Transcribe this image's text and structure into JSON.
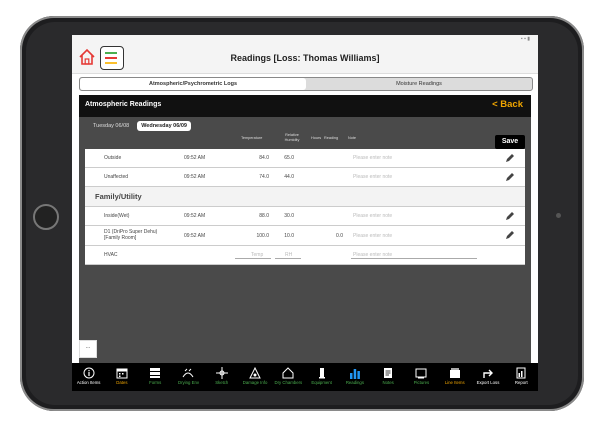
{
  "window": {
    "title": "Readings [Loss: Thomas  Williams]"
  },
  "segments": [
    "Atmospheric/Psychrometric Logs",
    "Moisture Readings"
  ],
  "panel": {
    "title": "Atmospheric  Readings",
    "back_label": "< Back"
  },
  "day_tabs": [
    "Tuesday 06/08",
    "Wednesday 06/09"
  ],
  "save_label": "Save",
  "columns": {
    "temperature": "Temperature",
    "relative_humidity": "Relative Humidity",
    "hours": "Hours",
    "reading": "Reading",
    "note": "Note"
  },
  "rows": [
    {
      "name": "Outside",
      "time": "09:52 AM",
      "temperature": "84.0",
      "humidity": "65.0",
      "note_placeholder": "Please enter note"
    },
    {
      "name": "Unaffected",
      "time": "09:52 AM",
      "temperature": "74.0",
      "humidity": "44.0",
      "note_placeholder": "Please enter note"
    },
    {
      "group": "Family/Utility"
    },
    {
      "name": "Inside(Wet)",
      "time": "09:52 AM",
      "temperature": "88.0",
      "humidity": "30.0",
      "note_placeholder": "Please enter note"
    },
    {
      "name": "D1 (DriPro Super Dehu) [Family Room]",
      "time": "09:52 AM",
      "temperature": "100.0",
      "humidity": "10.0",
      "reading": "0.0",
      "note_placeholder": "Please enter note"
    },
    {
      "name": "HVAC",
      "temp_placeholder": "Temp",
      "rh_placeholder": "RH",
      "note_placeholder": "Please enter note"
    }
  ],
  "chat_label": "...",
  "toolbar": [
    {
      "label": "Action Items",
      "icon": "info-icon",
      "color": "#ffffff"
    },
    {
      "label": "Dates",
      "icon": "calendar-icon",
      "color": "#f0a500"
    },
    {
      "label": "Forms",
      "icon": "forms-icon",
      "color": "#4caf50"
    },
    {
      "label": "Drying Env",
      "icon": "drying-env-icon",
      "color": "#4caf50"
    },
    {
      "label": "Sketch",
      "icon": "sketch-icon",
      "color": "#4caf50"
    },
    {
      "label": "Damage Info",
      "icon": "damage-icon",
      "color": "#4caf50"
    },
    {
      "label": "Dry Chambers",
      "icon": "house-icon",
      "color": "#4caf50"
    },
    {
      "label": "Equipment",
      "icon": "equipment-icon",
      "color": "#4caf50"
    },
    {
      "label": "Readings",
      "icon": "bar-chart-icon",
      "color": "#4caf50"
    },
    {
      "label": "Notes",
      "icon": "notes-icon",
      "color": "#4caf50"
    },
    {
      "label": "Pictures",
      "icon": "pictures-icon",
      "color": "#4caf50"
    },
    {
      "label": "Line Items",
      "icon": "line-items-icon",
      "color": "#f0a500"
    },
    {
      "label": "Export Loss",
      "icon": "export-icon",
      "color": "#ffffff"
    },
    {
      "label": "Report",
      "icon": "report-icon",
      "color": "#ffffff"
    }
  ]
}
